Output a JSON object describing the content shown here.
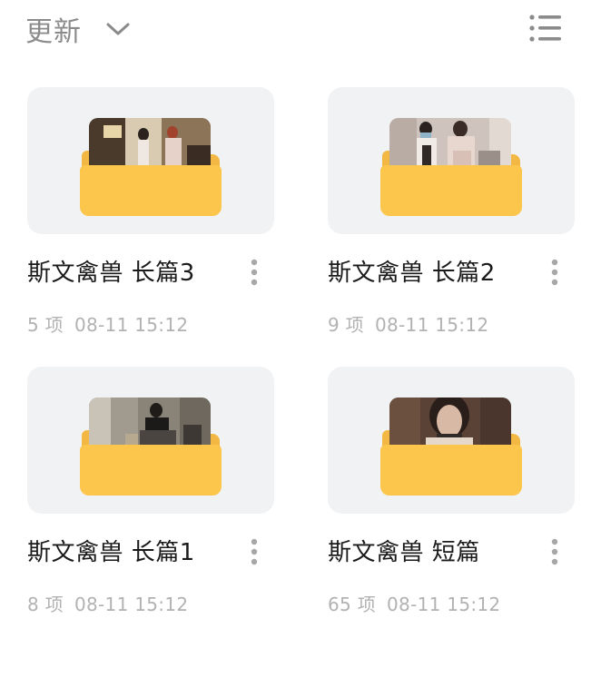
{
  "header": {
    "sort_label": "更新",
    "sort_icon": "chevron-down-icon",
    "view_icon": "list-view-icon"
  },
  "colors": {
    "folder_front": "#fcc64d",
    "folder_back": "#f3b843",
    "card_bg": "#f1f2f4",
    "meta_text": "#b2b2b2",
    "header_text": "#8b8b8b"
  },
  "folders": [
    {
      "name": "斯文禽兽 长篇3",
      "count": "5 项",
      "date": "08-11 15:12",
      "more_icon": "more-vertical-icon"
    },
    {
      "name": "斯文禽兽 长篇2",
      "count": "9 项",
      "date": "08-11 15:12",
      "more_icon": "more-vertical-icon"
    },
    {
      "name": "斯文禽兽 长篇1",
      "count": "8 项",
      "date": "08-11 15:12",
      "more_icon": "more-vertical-icon"
    },
    {
      "name": "斯文禽兽 短篇",
      "count": "65 项",
      "date": "08-11 15:12",
      "more_icon": "more-vertical-icon"
    }
  ]
}
